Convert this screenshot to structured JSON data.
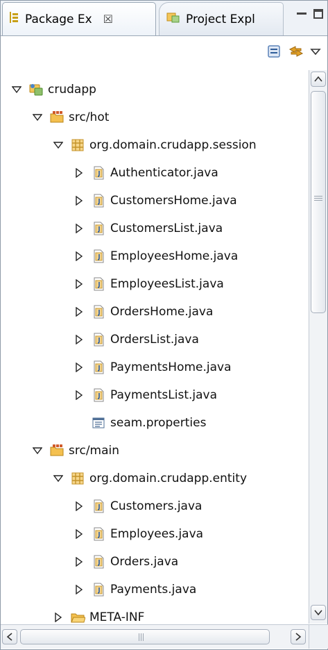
{
  "tabs": [
    {
      "label": "Package Ex",
      "close": "☒",
      "icon": "package-explorer-icon",
      "active": true
    },
    {
      "label": "Project Expl",
      "icon": "project-explorer-icon",
      "active": false
    }
  ],
  "toolbar": {
    "icons": [
      "collapse-all-icon",
      "link-with-editor-icon",
      "view-menu-icon"
    ]
  },
  "tree": [
    {
      "label": "crudapp",
      "depth": 0,
      "twisty": "expanded",
      "icon": "project"
    },
    {
      "label": "src/hot",
      "depth": 1,
      "twisty": "expanded",
      "icon": "source-folder"
    },
    {
      "label": "org.domain.crudapp.session",
      "depth": 2,
      "twisty": "expanded",
      "icon": "package"
    },
    {
      "label": "Authenticator.java",
      "depth": 3,
      "twisty": "collapsed",
      "icon": "java-file"
    },
    {
      "label": "CustomersHome.java",
      "depth": 3,
      "twisty": "collapsed",
      "icon": "java-file"
    },
    {
      "label": "CustomersList.java",
      "depth": 3,
      "twisty": "collapsed",
      "icon": "java-file"
    },
    {
      "label": "EmployeesHome.java",
      "depth": 3,
      "twisty": "collapsed",
      "icon": "java-file"
    },
    {
      "label": "EmployeesList.java",
      "depth": 3,
      "twisty": "collapsed",
      "icon": "java-file"
    },
    {
      "label": "OrdersHome.java",
      "depth": 3,
      "twisty": "collapsed",
      "icon": "java-file"
    },
    {
      "label": "OrdersList.java",
      "depth": 3,
      "twisty": "collapsed",
      "icon": "java-file"
    },
    {
      "label": "PaymentsHome.java",
      "depth": 3,
      "twisty": "collapsed",
      "icon": "java-file"
    },
    {
      "label": "PaymentsList.java",
      "depth": 3,
      "twisty": "collapsed",
      "icon": "java-file"
    },
    {
      "label": "seam.properties",
      "depth": 3,
      "twisty": "none",
      "icon": "properties-file"
    },
    {
      "label": "src/main",
      "depth": 1,
      "twisty": "expanded",
      "icon": "source-folder"
    },
    {
      "label": "org.domain.crudapp.entity",
      "depth": 2,
      "twisty": "expanded",
      "icon": "package"
    },
    {
      "label": "Customers.java",
      "depth": 3,
      "twisty": "collapsed",
      "icon": "java-file"
    },
    {
      "label": "Employees.java",
      "depth": 3,
      "twisty": "collapsed",
      "icon": "java-file"
    },
    {
      "label": "Orders.java",
      "depth": 3,
      "twisty": "collapsed",
      "icon": "java-file"
    },
    {
      "label": "Payments.java",
      "depth": 3,
      "twisty": "collapsed",
      "icon": "java-file"
    },
    {
      "label": "META-INF",
      "depth": 2,
      "twisty": "collapsed",
      "icon": "folder"
    }
  ],
  "scrollbars": {
    "vertical": "visible",
    "horizontal": "visible"
  }
}
